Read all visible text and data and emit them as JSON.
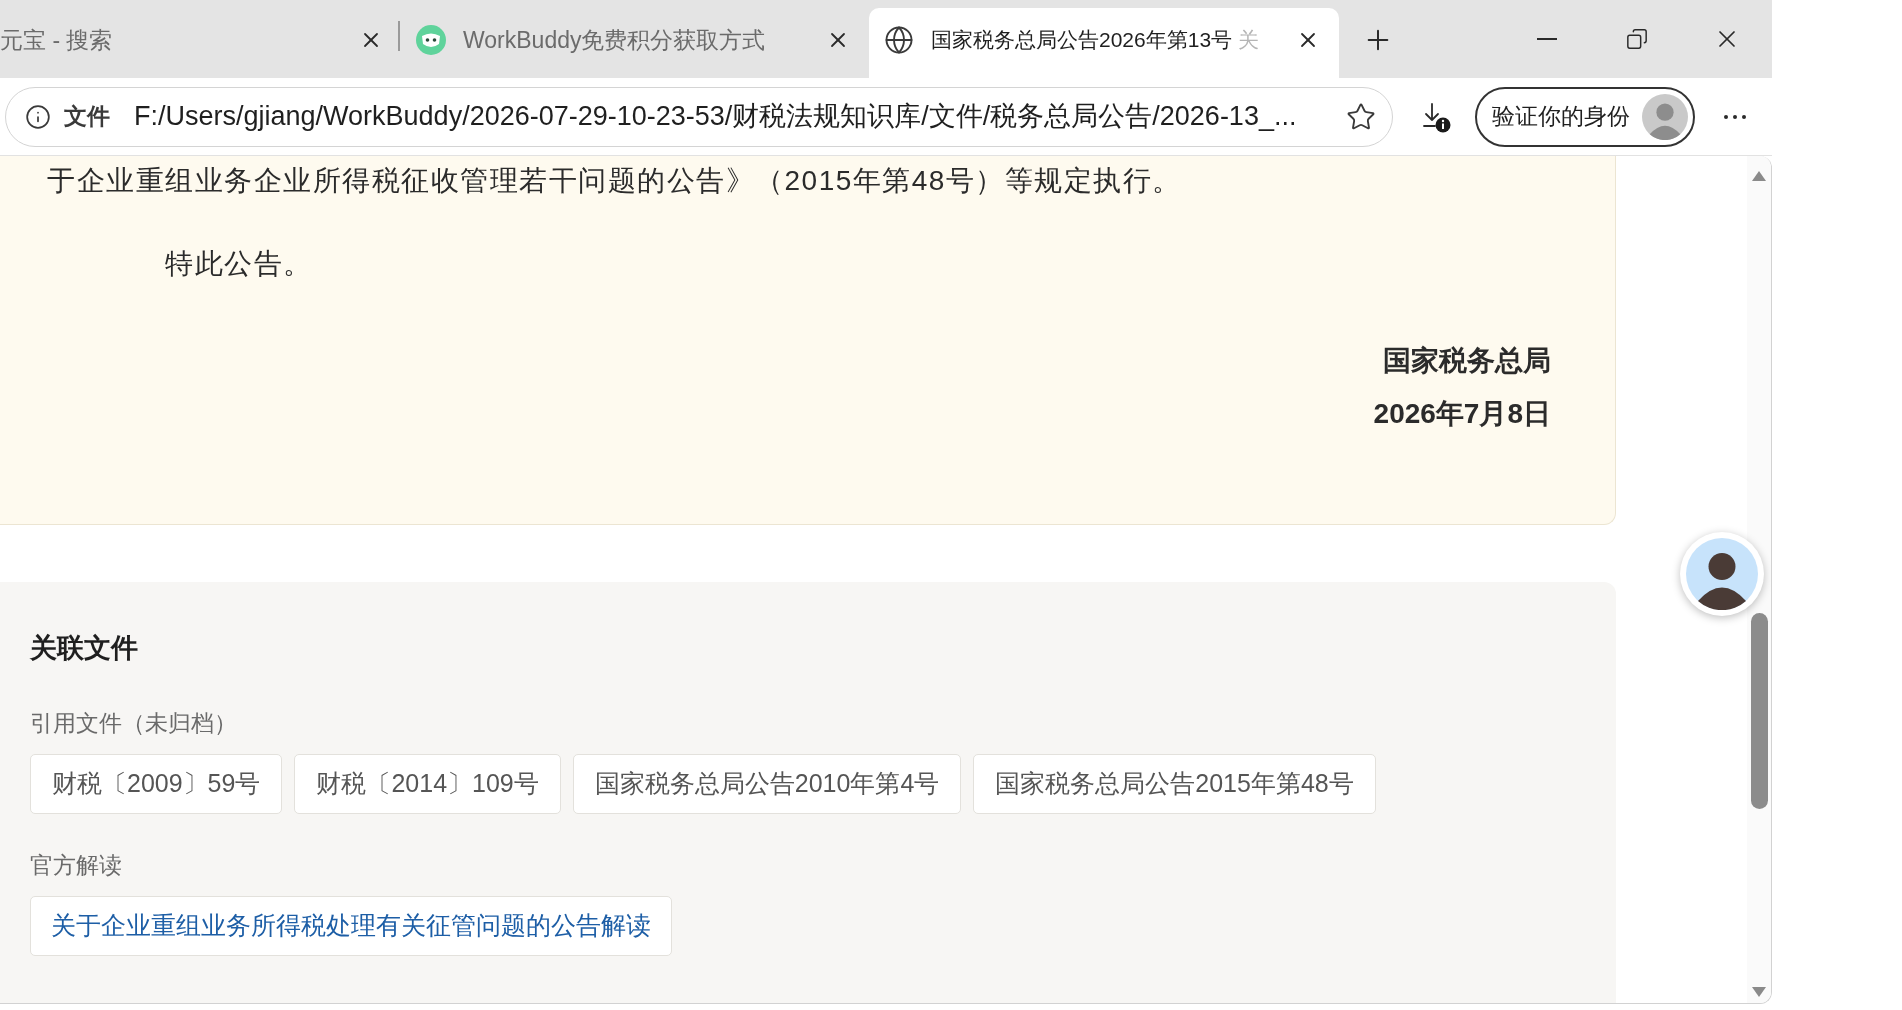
{
  "tabs": [
    {
      "title": "元宝 - 搜索",
      "kind": "clipped",
      "selected": false
    },
    {
      "title": "WorkBuddy免费积分获取方式",
      "kind": "app",
      "selected": false
    },
    {
      "title": "国家税务总局公告2026年第13号 关",
      "kind": "web",
      "selected": true
    }
  ],
  "address_bar": {
    "scheme_label": "文件",
    "url": "F:/Users/gjiang/WorkBuddy/2026-07-29-10-23-53/财税法规知识库/文件/税务总局公告/2026-13_..."
  },
  "profile_button": {
    "label": "验证你的身份"
  },
  "announcement": {
    "paragraphs": [
      {
        "kind": "body",
        "text": "于企业重组业务企业所得税征收管理若干问题的公告》（2015年第48号）等规定执行。"
      },
      {
        "kind": "indented",
        "text": "特此公告。"
      },
      {
        "kind": "signature",
        "text": "国家税务总局"
      },
      {
        "kind": "signature",
        "text": "2026年7月8日"
      }
    ]
  },
  "related_files": {
    "title": "关联文件",
    "groups": [
      {
        "label": "引用文件（未归档）",
        "kind": "document",
        "items": [
          "财税〔2009〕59号",
          "财税〔2014〕109号",
          "国家税务总局公告2010年第4号",
          "国家税务总局公告2015年第48号"
        ]
      },
      {
        "label": "官方解读",
        "kind": "link",
        "items": [
          "关于企业重组业务所得税处理有关征管问题的公告解读"
        ]
      }
    ]
  }
}
